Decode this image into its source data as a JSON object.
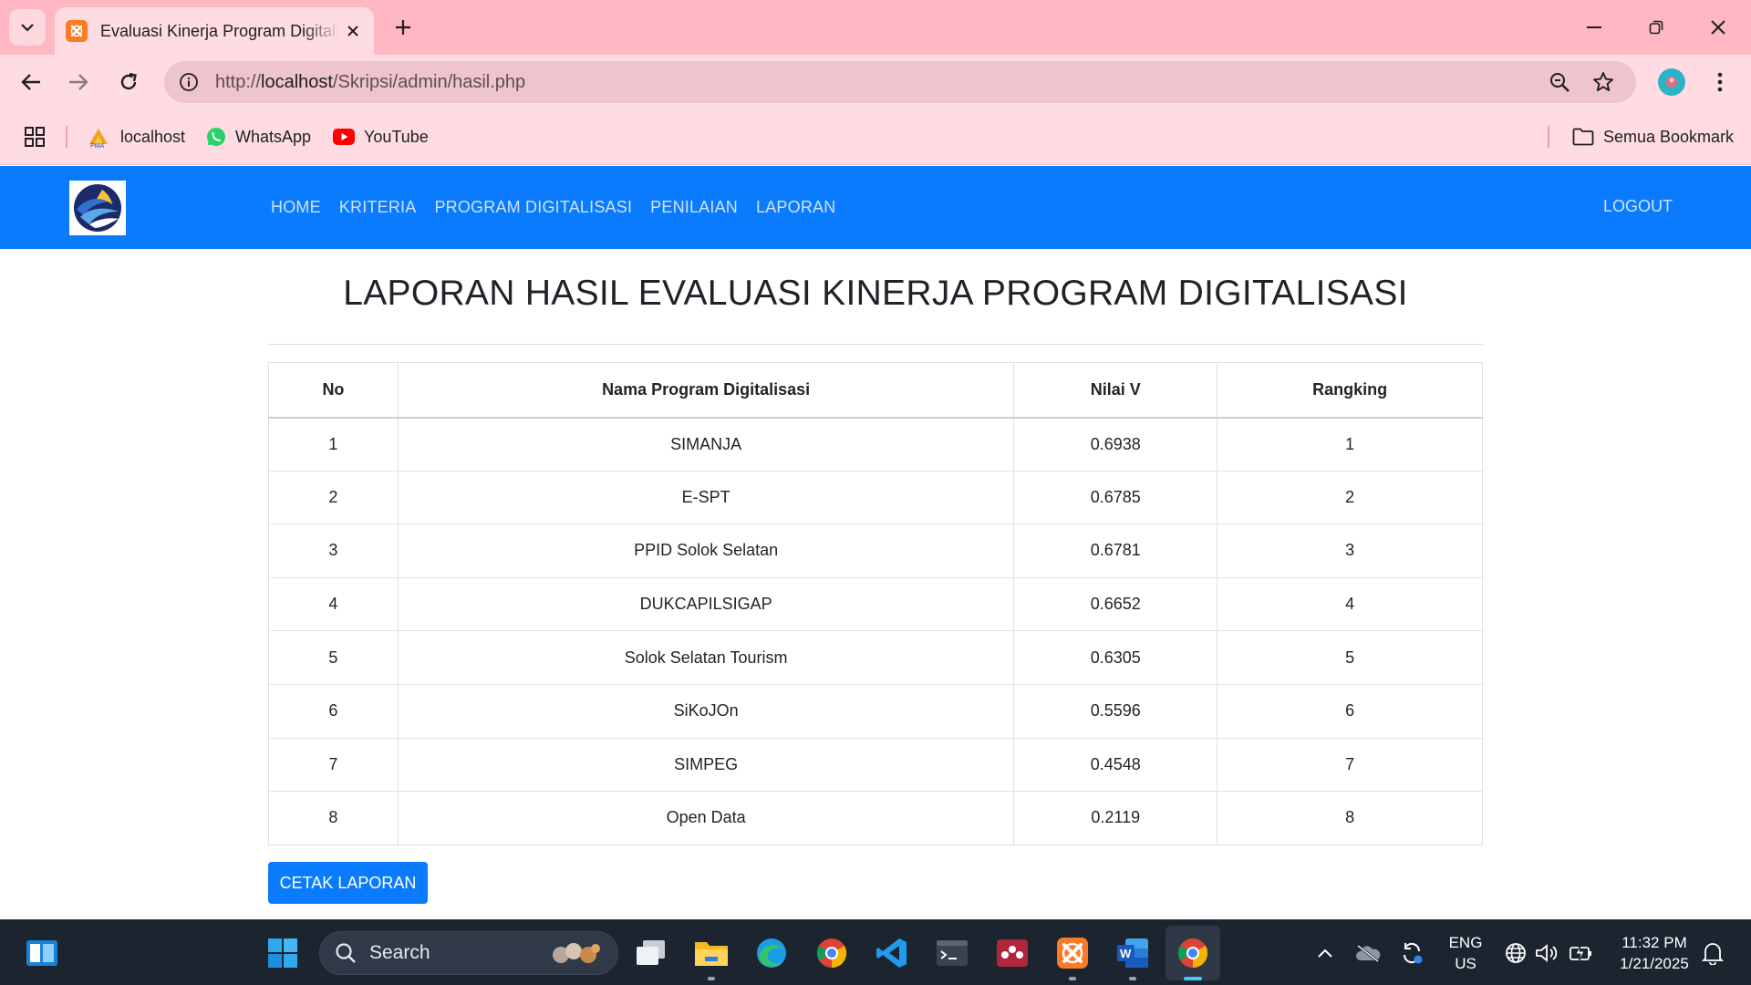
{
  "browser": {
    "tab_title": "Evaluasi Kinerja Program Digitalisasi",
    "url_prefix": "http://",
    "url_host": "localhost",
    "url_path": "/Skripsi/admin/hasil.php",
    "bookmarks": [
      {
        "label": "localhost",
        "icon": "xampp-pma-icon"
      },
      {
        "label": "WhatsApp",
        "icon": "whatsapp-icon"
      },
      {
        "label": "YouTube",
        "icon": "youtube-icon"
      }
    ],
    "all_bookmarks": "Semua Bookmark"
  },
  "nav": {
    "items": [
      "HOME",
      "KRITERIA",
      "PROGRAM DIGITALISASI",
      "PENILAIAN",
      "LAPORAN"
    ],
    "logout": "LOGOUT"
  },
  "report": {
    "title": "LAPORAN HASIL EVALUASI KINERJA PROGRAM DIGITALISASI",
    "columns": [
      "No",
      "Nama Program Digitalisasi",
      "Nilai V",
      "Rangking"
    ],
    "rows": [
      [
        "1",
        "SIMANJA",
        "0.6938",
        "1"
      ],
      [
        "2",
        "E-SPT",
        "0.6785",
        "2"
      ],
      [
        "3",
        "PPID Solok Selatan",
        "0.6781",
        "3"
      ],
      [
        "4",
        "DUKCAPILSIGAP",
        "0.6652",
        "4"
      ],
      [
        "5",
        "Solok Selatan Tourism",
        "0.6305",
        "5"
      ],
      [
        "6",
        "SiKoJOn",
        "0.5596",
        "6"
      ],
      [
        "7",
        "SIMPEG",
        "0.4548",
        "7"
      ],
      [
        "8",
        "Open Data",
        "0.2119",
        "8"
      ]
    ],
    "print_button": "CETAK LAPORAN"
  },
  "taskbar": {
    "search_label": "Search",
    "lang_line1": "ENG",
    "lang_line2": "US",
    "time": "11:32 PM",
    "date": "1/21/2025"
  },
  "colors": {
    "tabbar": "#ffb7c4",
    "chrome": "#ffdce3",
    "navbar": "#0a7bfd",
    "button": "#0a7bfd",
    "taskbar": "#1c2430"
  }
}
